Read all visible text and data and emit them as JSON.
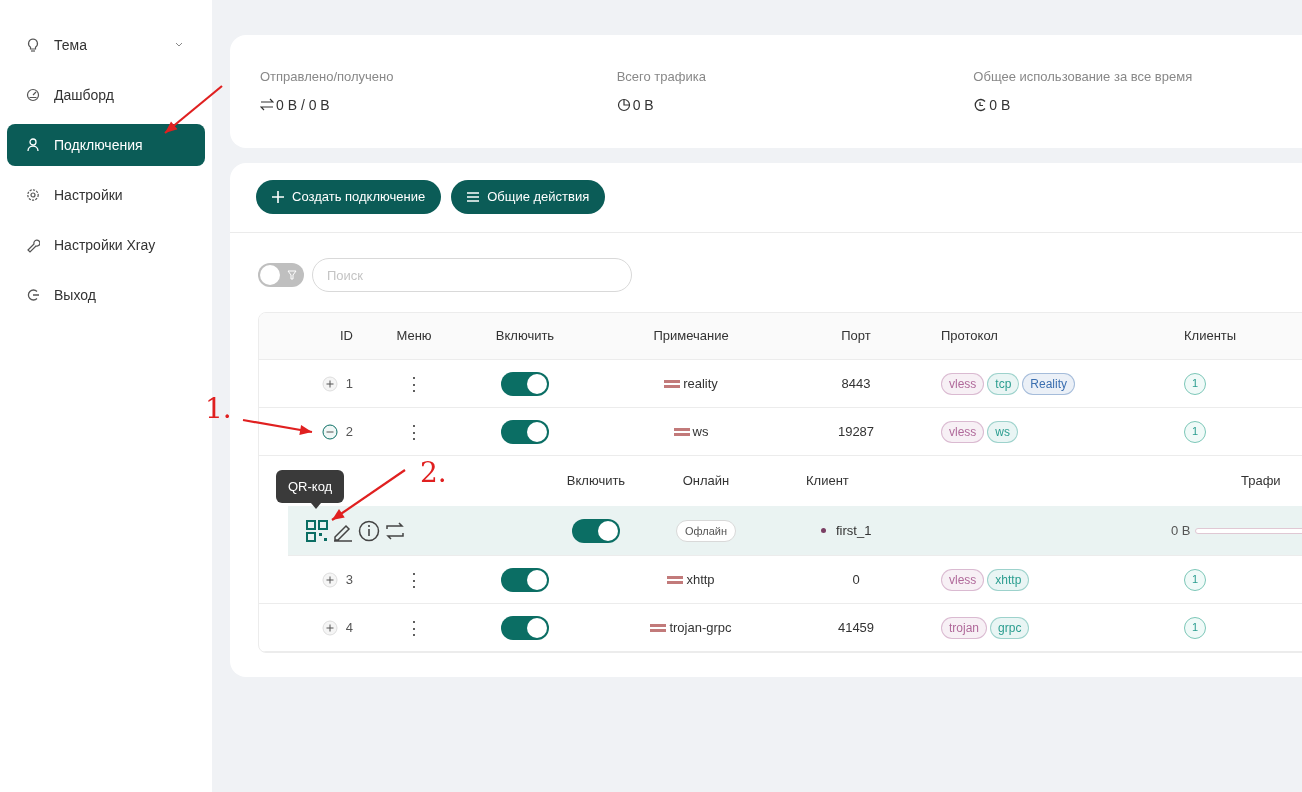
{
  "sidebar": {
    "items": [
      {
        "label": "Тема",
        "kind": "submenu",
        "selected": false
      },
      {
        "label": "Дашборд",
        "kind": "link",
        "selected": false
      },
      {
        "label": "Подключения",
        "kind": "link",
        "selected": true
      },
      {
        "label": "Настройки",
        "kind": "link",
        "selected": false
      },
      {
        "label": "Настройки Xray",
        "kind": "link",
        "selected": false
      },
      {
        "label": "Выход",
        "kind": "link",
        "selected": false
      }
    ]
  },
  "stats": [
    {
      "label": "Отправлено/получено",
      "value": "0 B / 0 B"
    },
    {
      "label": "Всего трафика",
      "value": "0 B"
    },
    {
      "label": "Общее использование за все время",
      "value": "0 B"
    }
  ],
  "toolbar": {
    "buttons": [
      {
        "label": "Создать подключение"
      },
      {
        "label": "Общие действия"
      }
    ]
  },
  "filter": {
    "on": false,
    "placeholder": "Поиск"
  },
  "table": {
    "columns": [
      "ID",
      "Меню",
      "Включить",
      "Примечание",
      "Порт",
      "Протокол",
      "Клиенты"
    ],
    "rows": [
      {
        "id": "1",
        "expanded": false,
        "menu": "⋮",
        "enabled": true,
        "remark": "reality",
        "port": "8443",
        "protocols": [
          {
            "label": "vless",
            "color": "#b0699a"
          },
          {
            "label": "tcp",
            "color": "#2a9d8f"
          },
          {
            "label": "Reality",
            "color": "#3b6fb0"
          }
        ],
        "clients": "1"
      },
      {
        "id": "2",
        "expanded": true,
        "menu": "⋮",
        "enabled": true,
        "remark": "ws",
        "port": "19287",
        "protocols": [
          {
            "label": "vless",
            "color": "#b0699a"
          },
          {
            "label": "ws",
            "color": "#2a9d8f"
          }
        ],
        "clients": "1",
        "detail": {
          "columns": [
            "Включить",
            "Онлайн",
            "Клиент",
            "Трафи"
          ],
          "clients": [
            {
              "enabled": true,
              "online": "Офлайн",
              "name": "first_1",
              "traffic": "0 B",
              "level": 0
            }
          ]
        }
      },
      {
        "id": "3",
        "expanded": false,
        "menu": "⋮",
        "enabled": true,
        "remark": "xhttp",
        "port": "0",
        "protocols": [
          {
            "label": "vless",
            "color": "#b0699a"
          },
          {
            "label": "xhttp",
            "color": "#2a9d8f"
          }
        ],
        "clients": "1"
      },
      {
        "id": "4",
        "expanded": false,
        "menu": "⋮",
        "enabled": true,
        "remark": "trojan-grpc",
        "port": "41459",
        "protocols": [
          {
            "label": "trojan",
            "color": "#b0699a"
          },
          {
            "label": "grpc",
            "color": "#2a9d8f"
          }
        ],
        "clients": "1"
      }
    ]
  },
  "tooltip": {
    "text": "QR-код"
  },
  "annotations": [
    {
      "label": "1."
    },
    {
      "label": "2."
    }
  ]
}
